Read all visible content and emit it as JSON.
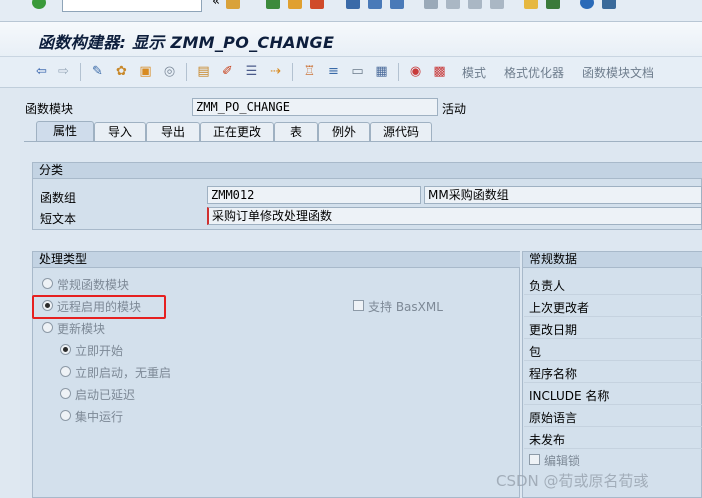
{
  "title": "函数构建器: 显示 ZMM_PO_CHANGE",
  "toolbar": {
    "text_buttons": [
      "模式",
      "格式优化器",
      "函数模块文档"
    ]
  },
  "header": {
    "function_module_label": "函数模块",
    "function_module_value": "ZMM_PO_CHANGE",
    "status": "活动"
  },
  "tabs": [
    {
      "label": "属性",
      "active": true
    },
    {
      "label": "导入"
    },
    {
      "label": "导出"
    },
    {
      "label": "正在更改"
    },
    {
      "label": "表"
    },
    {
      "label": "例外"
    },
    {
      "label": "源代码"
    }
  ],
  "classification": {
    "title": "分类",
    "function_group_label": "函数组",
    "function_group_value": "ZMM012",
    "function_group_desc": "MM采购函数组",
    "short_text_label": "短文本",
    "short_text_value": "采购订单修改处理函数"
  },
  "processing": {
    "title": "处理类型",
    "options": [
      {
        "label": "常规函数模块",
        "selected": false
      },
      {
        "label": "远程启用的模块",
        "selected": true
      },
      {
        "label": "更新模块",
        "selected": false
      }
    ],
    "basxml_label": "支持 BasXML",
    "update_options": [
      {
        "label": "立即开始",
        "selected": true
      },
      {
        "label": "立即启动，无重启",
        "selected": false
      },
      {
        "label": "启动已延迟",
        "selected": false
      },
      {
        "label": "集中运行",
        "selected": false
      }
    ]
  },
  "general_data": {
    "title": "常规数据",
    "fields": [
      "负责人",
      "上次更改者",
      "更改日期",
      "包",
      "程序名称",
      "INCLUDE 名称",
      "原始语言",
      "未发布"
    ],
    "edit_lock_label": "编辑锁"
  },
  "watermark": "CSDN @荀或原名荀彧",
  "colors": {
    "highlight_box": "#e62020",
    "toolbar_bg": "#e6eef6"
  }
}
